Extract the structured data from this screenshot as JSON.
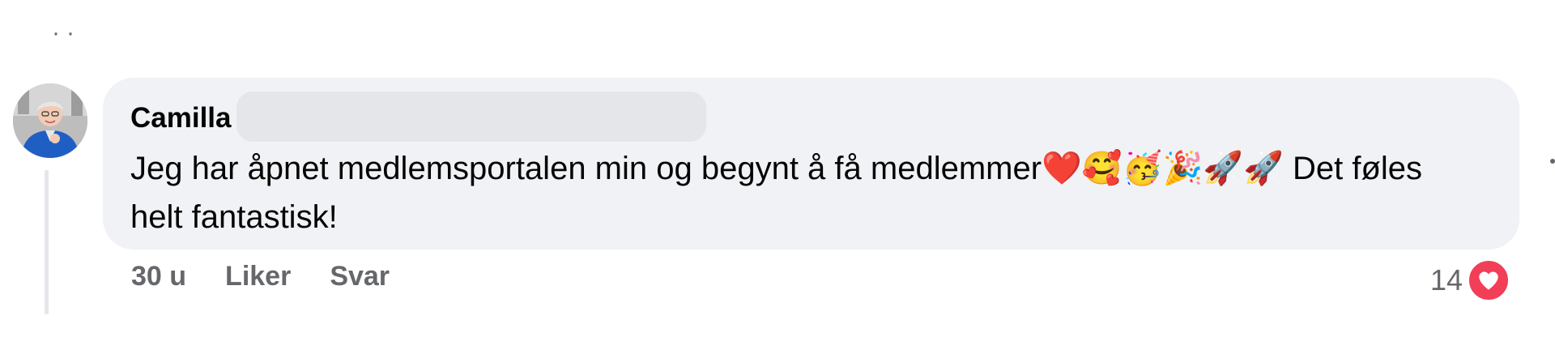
{
  "comment": {
    "author": "Camilla",
    "text": "Jeg har åpnet medlemsportalen min og begynt å få medlemmer❤️🥰🥳🎉🚀🚀 Det føles helt fantastisk!",
    "timestamp": "30 u",
    "like_label": "Liker",
    "reply_label": "Svar",
    "reaction_count": "14",
    "reaction_icon": "heart-icon"
  },
  "colors": {
    "bubble": "#f0f2f5",
    "meta_text": "#65676b",
    "heart": "#f33e58"
  }
}
